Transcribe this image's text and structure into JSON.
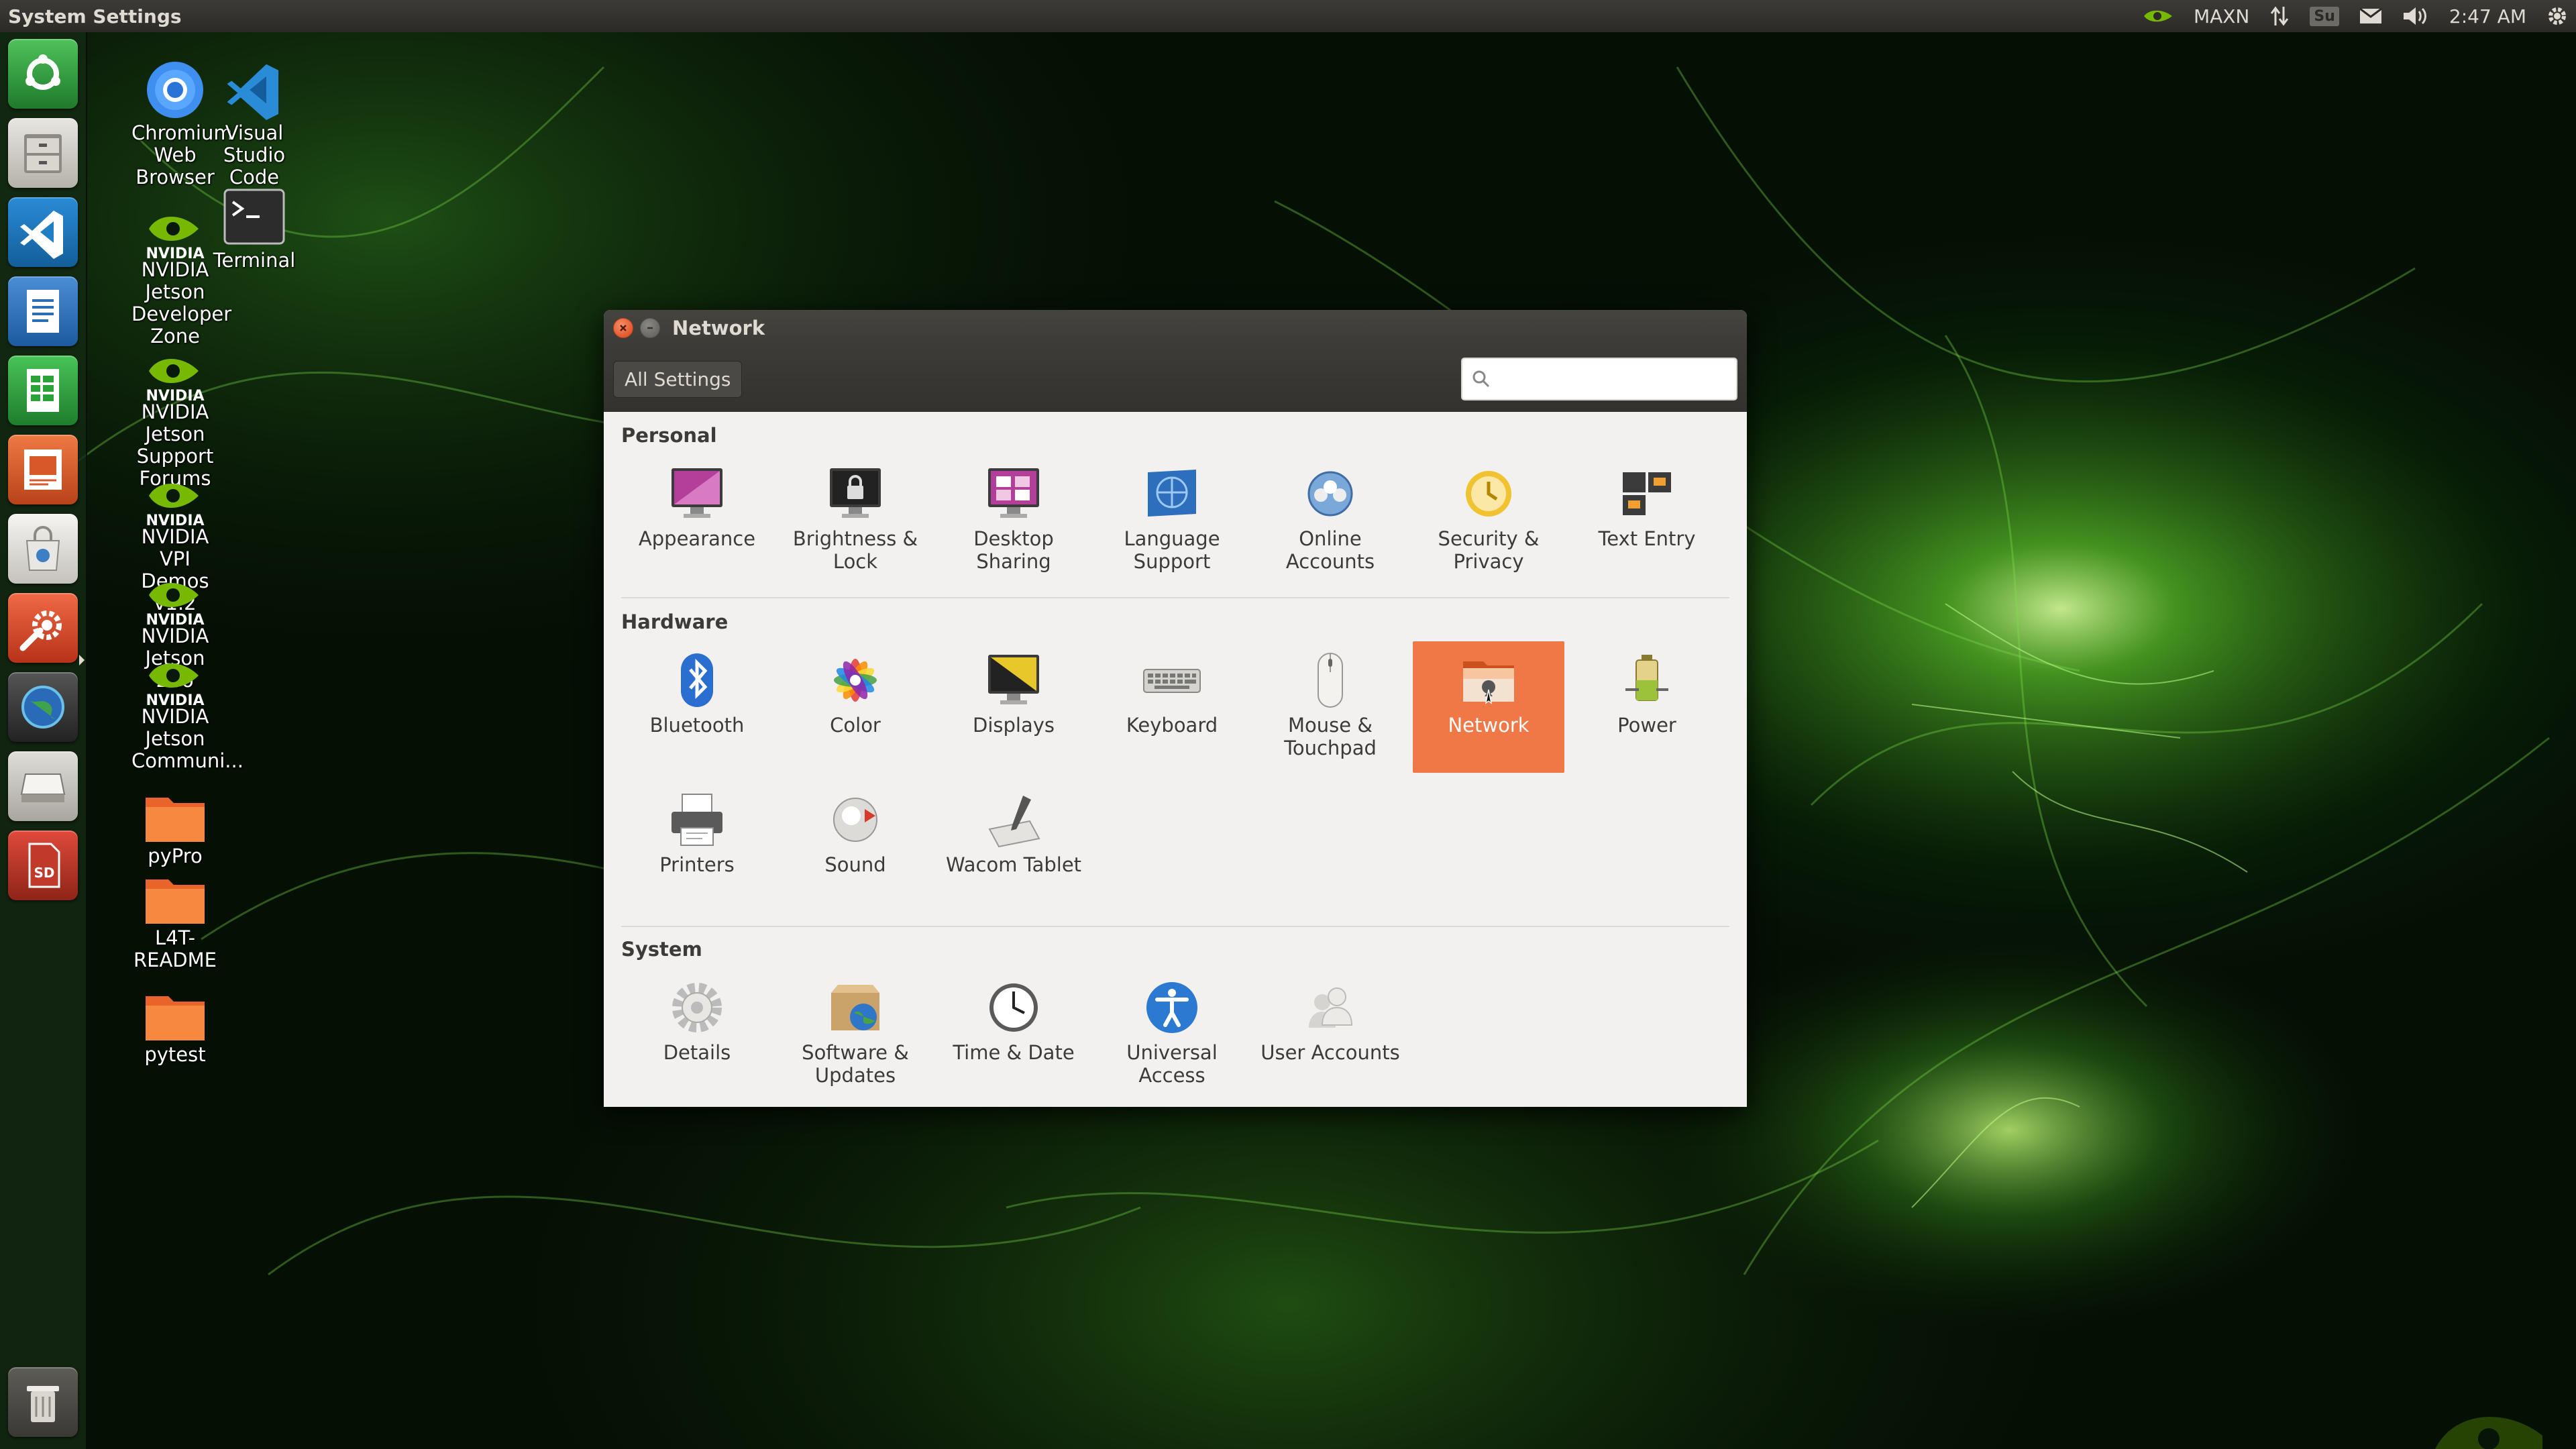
{
  "top_panel": {
    "app_title": "System Settings",
    "power_mode": "MAXN",
    "keyboard_indicator": "Su",
    "clock": "2:47 AM",
    "icons": [
      "nvidia-icon",
      "network-arrows-icon",
      "keyboard-layout-icon",
      "mail-icon",
      "volume-icon",
      "gear-icon"
    ]
  },
  "launcher": {
    "items": [
      {
        "name": "ubuntu-dash",
        "icon": "ubuntu-logo-icon",
        "color": "#2e9a3c"
      },
      {
        "name": "files",
        "icon": "file-cabinet-icon",
        "color": "#e8e6e1"
      },
      {
        "name": "vscode",
        "icon": "vscode-icon",
        "color": "#1f7fc4"
      },
      {
        "name": "writer",
        "icon": "document-icon",
        "color": "#2a6fb6"
      },
      {
        "name": "calc",
        "icon": "spreadsheet-icon",
        "color": "#2ba339"
      },
      {
        "name": "impress",
        "icon": "presentation-icon",
        "color": "#d9582a"
      },
      {
        "name": "software-center",
        "icon": "shopping-bag-icon",
        "color": "#e9e7e3"
      },
      {
        "name": "system-settings",
        "icon": "wrench-gear-icon",
        "color": "#d94b2b"
      },
      {
        "name": "chromium",
        "icon": "globe-icon",
        "color": "#3b3b3b"
      },
      {
        "name": "drive",
        "icon": "disk-drive-icon",
        "color": "#d6d4cf"
      },
      {
        "name": "sd-card",
        "icon": "sd-card-icon",
        "color": "#c0392b"
      }
    ],
    "trash_icon": "trash-icon"
  },
  "desktop": {
    "icons": [
      {
        "label": "Chromium Web Browser",
        "icon": "chromium-icon"
      },
      {
        "label": "Visual Studio Code",
        "icon": "vscode-icon"
      },
      {
        "label": "NVIDIA Jetson Developer Zone",
        "icon": "nvidia-icon"
      },
      {
        "label": "Terminal",
        "icon": "terminal-icon"
      },
      {
        "label": "NVIDIA Jetson Support Forums",
        "icon": "nvidia-icon"
      },
      {
        "label": "NVIDIA VPI Demos v1.2",
        "icon": "nvidia-icon"
      },
      {
        "label": "NVIDIA Jetson Zoo",
        "icon": "nvidia-icon"
      },
      {
        "label": "NVIDIA Jetson Communi...",
        "icon": "nvidia-icon"
      },
      {
        "label": "pyPro",
        "icon": "folder-icon"
      },
      {
        "label": "L4T-README",
        "icon": "folder-icon"
      },
      {
        "label": "pytest",
        "icon": "folder-icon"
      }
    ]
  },
  "window": {
    "title": "Network",
    "all_settings_label": "All Settings",
    "search_placeholder": "",
    "sections": [
      {
        "title": "Personal",
        "items": [
          {
            "label": "Appearance",
            "icon": "appearance-icon"
          },
          {
            "label": "Brightness & Lock",
            "icon": "brightness-lock-icon"
          },
          {
            "label": "Desktop Sharing",
            "icon": "desktop-sharing-icon"
          },
          {
            "label": "Language Support",
            "icon": "language-support-icon"
          },
          {
            "label": "Online Accounts",
            "icon": "online-accounts-icon"
          },
          {
            "label": "Security & Privacy",
            "icon": "security-privacy-icon"
          },
          {
            "label": "Text Entry",
            "icon": "text-entry-icon"
          }
        ]
      },
      {
        "title": "Hardware",
        "items": [
          {
            "label": "Bluetooth",
            "icon": "bluetooth-icon"
          },
          {
            "label": "Color",
            "icon": "color-icon"
          },
          {
            "label": "Displays",
            "icon": "displays-icon"
          },
          {
            "label": "Keyboard",
            "icon": "keyboard-icon"
          },
          {
            "label": "Mouse & Touchpad",
            "icon": "mouse-touchpad-icon"
          },
          {
            "label": "Network",
            "icon": "network-icon",
            "selected": true
          },
          {
            "label": "Power",
            "icon": "power-icon"
          },
          {
            "label": "Printers",
            "icon": "printers-icon"
          },
          {
            "label": "Sound",
            "icon": "sound-icon"
          },
          {
            "label": "Wacom Tablet",
            "icon": "wacom-tablet-icon"
          }
        ]
      },
      {
        "title": "System",
        "items": [
          {
            "label": "Details",
            "icon": "details-icon"
          },
          {
            "label": "Software & Updates",
            "icon": "software-updates-icon"
          },
          {
            "label": "Time & Date",
            "icon": "time-date-icon"
          },
          {
            "label": "Universal Access",
            "icon": "universal-access-icon"
          },
          {
            "label": "User Accounts",
            "icon": "user-accounts-icon"
          }
        ]
      }
    ]
  },
  "colors": {
    "selected_tile": "#f07746",
    "panel": "#3c3b37",
    "window_bg": "#f2f1f0"
  }
}
